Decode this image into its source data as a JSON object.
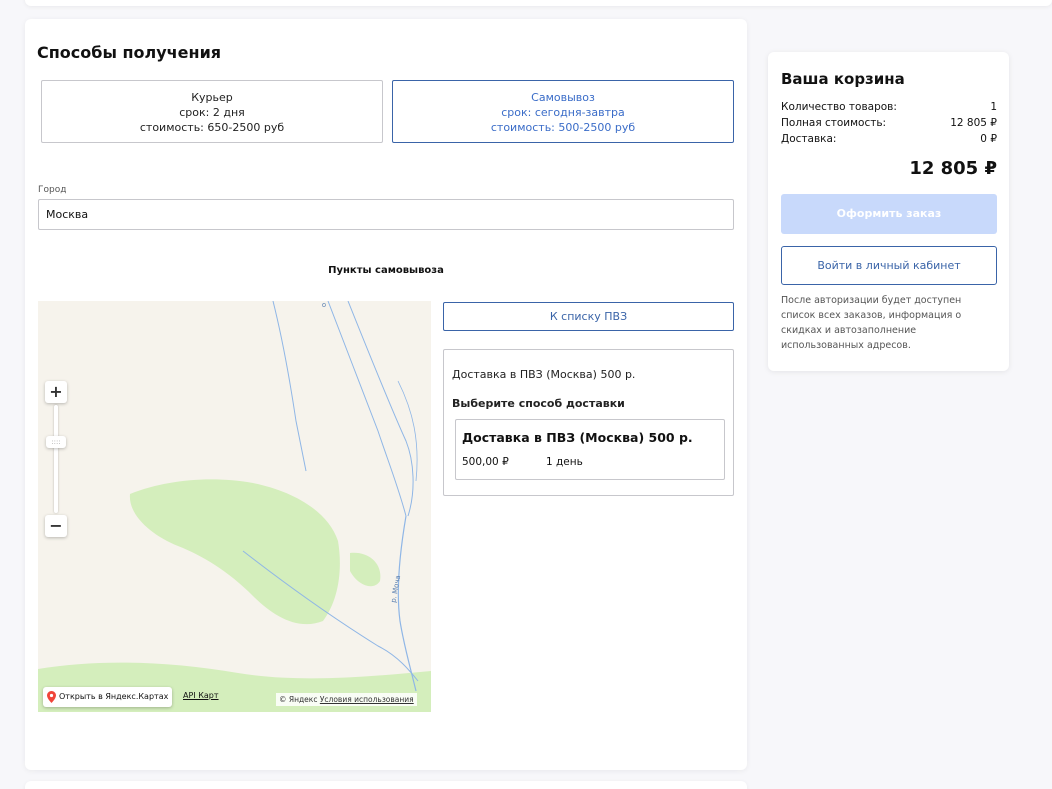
{
  "delivery": {
    "title": "Способы получения",
    "methods": [
      {
        "name": "Курьер",
        "term": "срок: 2 дня",
        "cost": "стоимость: 650-2500 руб"
      },
      {
        "name": "Самовывоз",
        "term": "срок: сегодня-завтра",
        "cost": "стоимость: 500-2500 руб"
      }
    ],
    "selected_method": "Самовывоз",
    "city_label": "Город",
    "city_value": "Москва",
    "pickup_title": "Пункты самовывоза"
  },
  "map": {
    "zoom_in": "+",
    "zoom_out": "−",
    "slider_grip": "::::",
    "river_label": "р. Моча",
    "river_label_top": "о",
    "open_in_yandex": "Открыть в Яндекс.Картах",
    "api_link": "API Карт",
    "copyright": "© Яндекс",
    "terms": "Условия использования"
  },
  "pvz": {
    "list_button": "К списку ПВЗ",
    "delivery_line": "Доставка в ПВЗ (Москва) 500 р.",
    "choose_label": "Выберите способ доставки",
    "option": {
      "title": "Доставка в ПВЗ (Москва) 500 р.",
      "price": "500,00 ₽",
      "days": "1 день"
    }
  },
  "cart": {
    "title": "Ваша корзина",
    "rows": [
      {
        "label": "Количество товаров:",
        "value": "1"
      },
      {
        "label": "Полная стоимость:",
        "value": "12 805 ₽"
      },
      {
        "label": "Доставка:",
        "value": "0 ₽"
      }
    ],
    "total": "12 805 ₽",
    "order_button": "Оформить заказ",
    "login_button": "Войти в личный кабинет",
    "note": "После авторизации будет доступен список всех заказов, информация о скидках и автозаполнение использованных адресов."
  },
  "colors": {
    "accent": "#3a64a8",
    "disabled_button": "#c8d9fb",
    "map_land": "#f6f3ec",
    "map_forest": "#d4eebc",
    "map_water": "#8fb6e6"
  },
  "icons": [
    "plus-icon",
    "minus-icon",
    "map-pin-icon"
  ]
}
